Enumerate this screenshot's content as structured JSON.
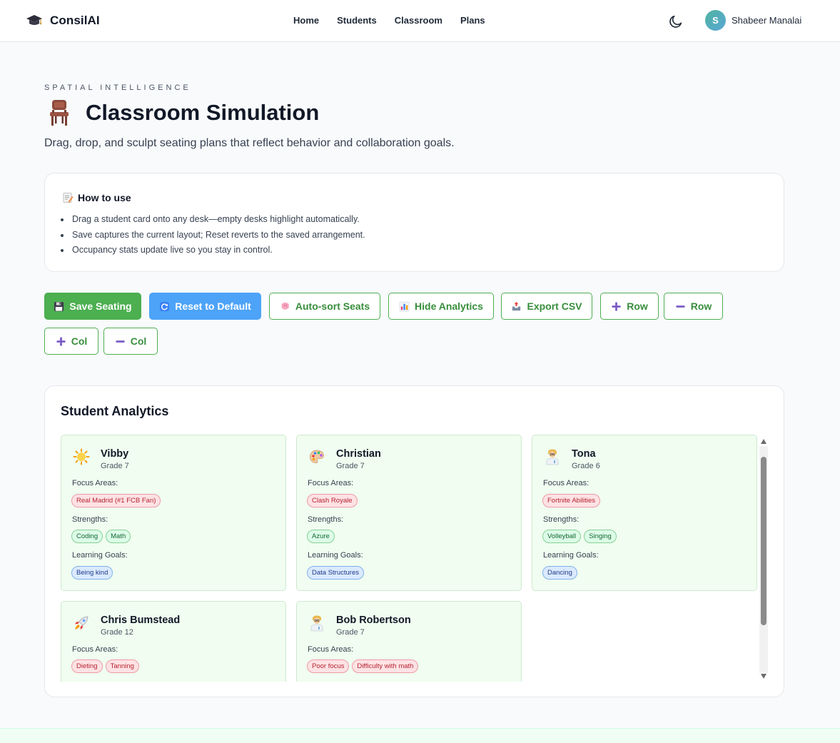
{
  "nav": {
    "brand": "ConsilAI",
    "links": [
      "Home",
      "Students",
      "Classroom",
      "Plans"
    ],
    "user_initial": "S",
    "user_name": "Shabeer Manalai"
  },
  "hero": {
    "eyebrow": "SPATIAL INTELLIGENCE",
    "title": "Classroom Simulation",
    "subtitle": "Drag, drop, and sculpt seating plans that reflect behavior and collaboration goals."
  },
  "howto": {
    "title": "How to use",
    "items": [
      "Drag a student card onto any desk—empty desks highlight automatically.",
      "Save captures the current layout; Reset reverts to the saved arrangement.",
      "Occupancy stats update live so you stay in control."
    ]
  },
  "toolbar": {
    "save": "Save Seating",
    "reset": "Reset to Default",
    "autosort": "Auto-sort Seats",
    "hide_analytics": "Hide Analytics",
    "export": "Export CSV",
    "add_row": "Row",
    "remove_row": "Row",
    "add_col": "Col",
    "remove_col": "Col"
  },
  "analytics": {
    "title": "Student Analytics",
    "labels": {
      "focus": "Focus Areas:",
      "strengths": "Strengths:",
      "goals": "Learning Goals:"
    },
    "students": [
      {
        "icon": "star-icon",
        "name": "Vibby",
        "grade": "Grade 7",
        "focus": [
          "Real Madrid (#1 FCB Fan)"
        ],
        "strengths": [
          "Coding",
          "Math"
        ],
        "goals": [
          "Being kind"
        ]
      },
      {
        "icon": "palette-icon",
        "name": "Christian",
        "grade": "Grade 7",
        "focus": [
          "Clash Royale"
        ],
        "strengths": [
          "Azure"
        ],
        "goals": [
          "Data Structures"
        ]
      },
      {
        "icon": "scientist-icon",
        "name": "Tona",
        "grade": "Grade 6",
        "focus": [
          "Fortnite Abilities"
        ],
        "strengths": [
          "Volleyball",
          "Singing"
        ],
        "goals": [
          "Dancing"
        ]
      },
      {
        "icon": "rocket-icon",
        "name": "Chris Bumstead",
        "grade": "Grade 12",
        "focus": [
          "Dieting",
          "Tanning"
        ],
        "strengths": [],
        "goals": []
      },
      {
        "icon": "scientist-icon",
        "name": "Bob Robertson",
        "grade": "Grade 7",
        "focus": [
          "Poor focus",
          "Difficulty with math"
        ],
        "strengths": [],
        "goals": []
      }
    ]
  },
  "colors": {
    "primary_green": "#4caf50",
    "info_blue": "#4da3f7",
    "card_bg": "#f0fdf0",
    "focus_tag": "#fde2e4",
    "strength_tag": "#dcfce7",
    "goal_tag": "#dbeafe"
  }
}
